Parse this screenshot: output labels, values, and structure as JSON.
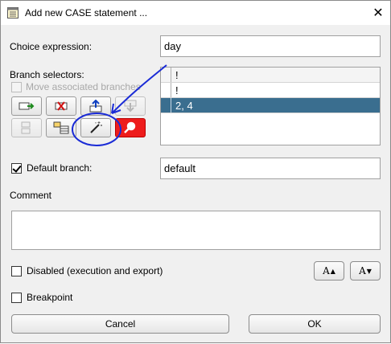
{
  "window": {
    "title": "Add new CASE statement ...",
    "close_glyph": "✕"
  },
  "choice": {
    "label": "Choice expression:",
    "value": "day"
  },
  "branch": {
    "label": "Branch selectors:",
    "move_associated": "Move associated branches",
    "items": [
      "!",
      "!",
      "2, 4"
    ],
    "selected_index": 2,
    "toolbar": [
      "add-branch-icon",
      "remove-branch-icon",
      "move-up-icon",
      "move-down-icon",
      "merge-branches-icon",
      "split-branch-icon",
      "magic-wand-icon",
      "search-icon"
    ]
  },
  "default_branch": {
    "label": "Default branch:",
    "checked": true,
    "value": "default"
  },
  "comment": {
    "label": "Comment",
    "value": ""
  },
  "disabled": {
    "label": "Disabled (execution and export)",
    "checked": false
  },
  "breakpoint": {
    "label": "Breakpoint",
    "checked": false
  },
  "font_buttons": {
    "larger": "A",
    "smaller": "A",
    "up": "▲",
    "down": "▼"
  },
  "buttons": {
    "cancel": "Cancel",
    "ok": "OK"
  },
  "annotation": {
    "color": "#1a2bd6"
  }
}
